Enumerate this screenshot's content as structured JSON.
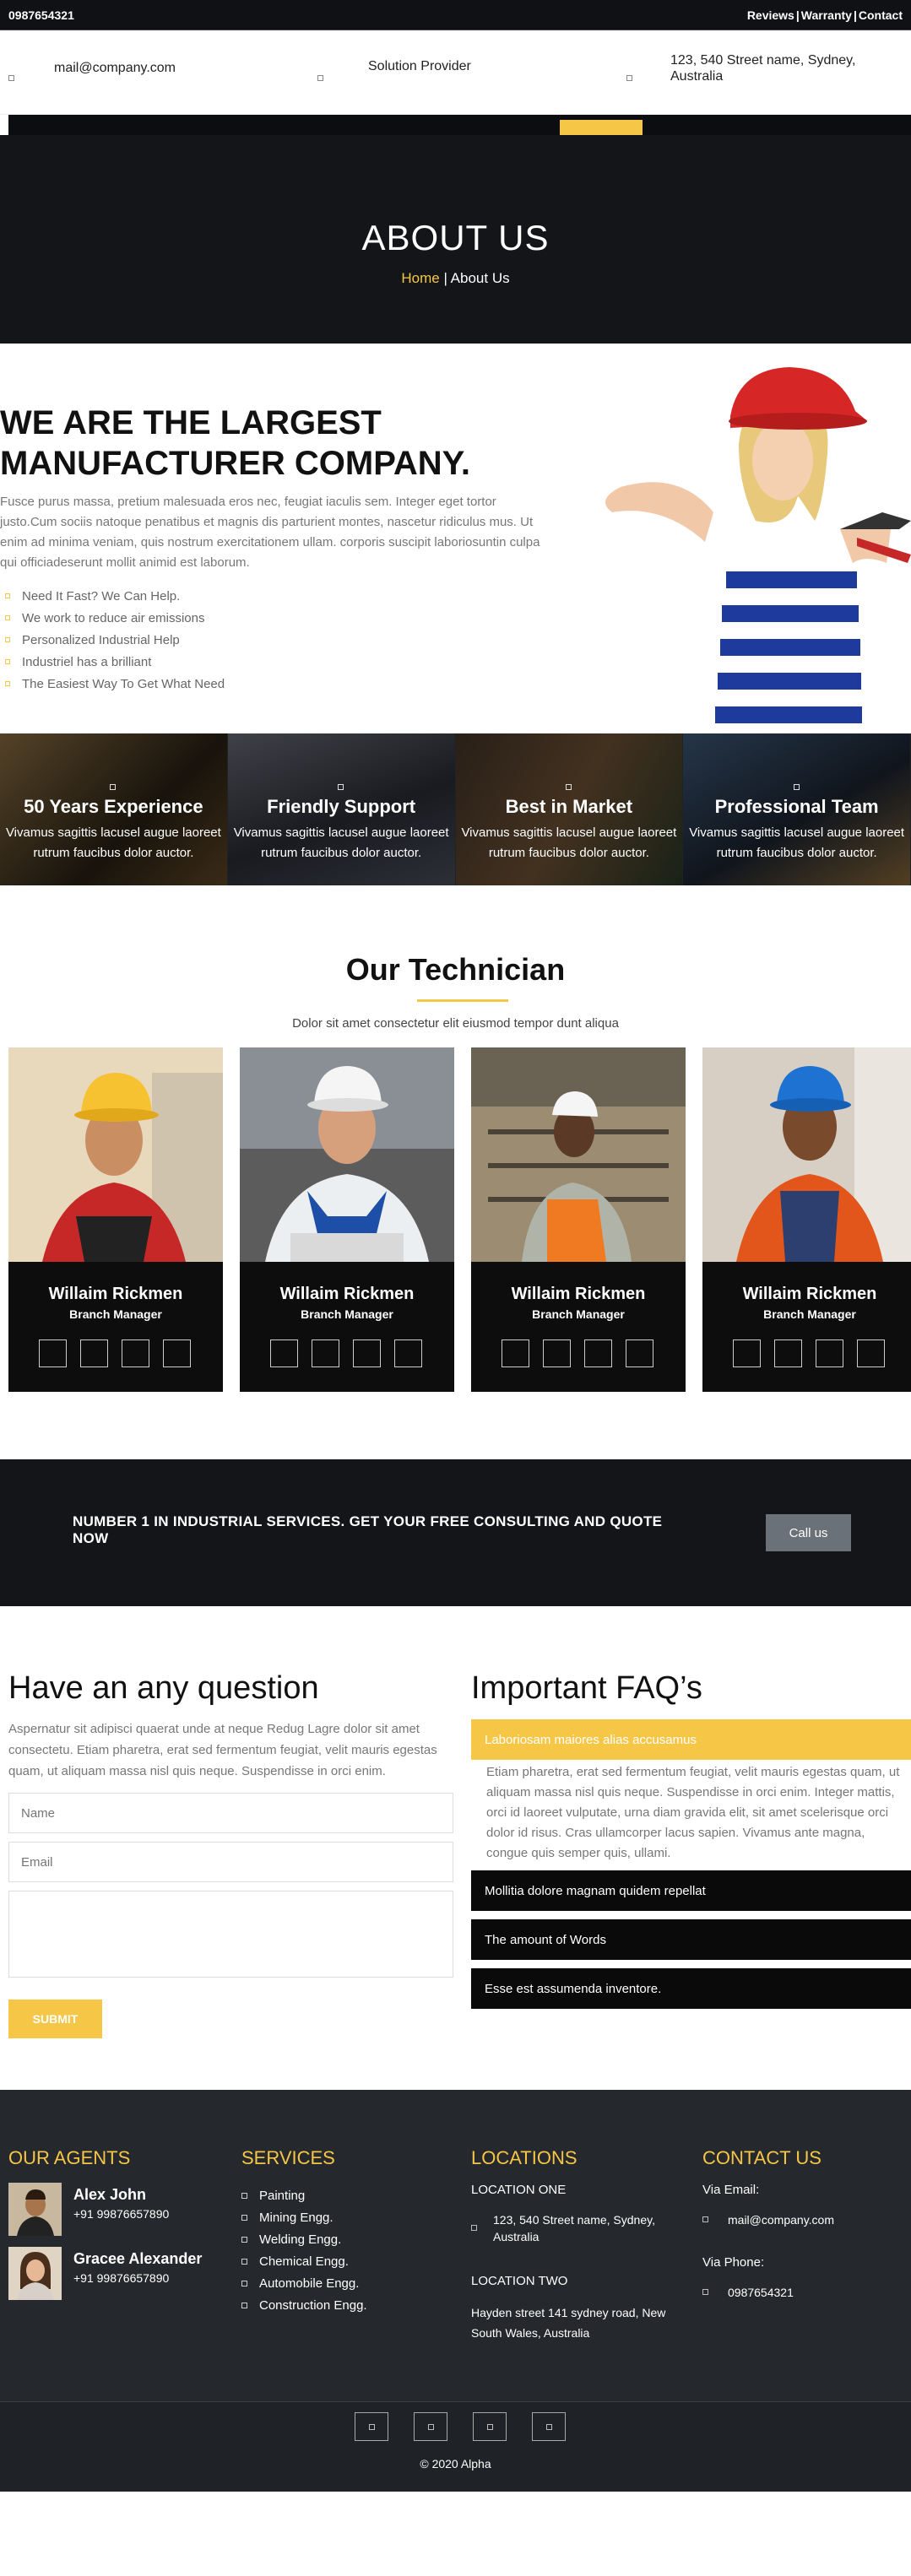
{
  "topbar": {
    "phone": "0987654321",
    "links": [
      "Reviews",
      "Warranty",
      "Contact"
    ],
    "sep": "|"
  },
  "infobar": {
    "email": "mail@company.com",
    "tagline": "Solution Provider",
    "address": "123, 540 Street name, Sydney, Australia"
  },
  "header": {
    "title": "ABOUT US",
    "crumb_home": "Home",
    "crumb_sep": " | ",
    "crumb_current": "About Us"
  },
  "about": {
    "heading": "WE ARE THE LARGEST MANUFACTURER COMPANY.",
    "text": "Fusce purus massa, pretium malesuada eros nec, feugiat iaculis sem. Integer eget tortor justo.Cum sociis natoque penatibus et magnis dis parturient montes, nascetur ridiculus mus. Ut enim ad minima veniam, quis nostrum exercitationem ullam. corporis suscipit laboriosuntin culpa qui officiadeserunt mollit animid est laborum.",
    "list": [
      "Need It Fast? We Can Help.",
      "We work to reduce air emissions",
      "Personalized Industrial Help",
      "Industriel has a brilliant",
      "The Easiest Way To Get What Need"
    ]
  },
  "features": [
    {
      "title": "50 Years Experience",
      "text": "Vivamus sagittis lacusel augue laoreet rutrum faucibus dolor auctor.",
      "bg": "#8a6a3c"
    },
    {
      "title": "Friendly Support",
      "text": "Vivamus sagittis lacusel augue laoreet rutrum faucibus dolor auctor.",
      "bg": "#3c4150"
    },
    {
      "title": "Best in Market",
      "text": "Vivamus sagittis lacusel augue laoreet rutrum faucibus dolor auctor.",
      "bg": "#5a4a3a"
    },
    {
      "title": "Professional Team",
      "text": "Vivamus sagittis lacusel augue laoreet rutrum faucibus dolor auctor.",
      "bg": "#2f3e4f"
    }
  ],
  "technicians": {
    "title": "Our Technician",
    "subtitle": "Dolor sit amet consectetur elit eiusmod tempor dunt aliqua",
    "members": [
      {
        "name": "Willaim Rickmen",
        "role": "Branch Manager"
      },
      {
        "name": "Willaim Rickmen",
        "role": "Branch Manager"
      },
      {
        "name": "Willaim Rickmen",
        "role": "Branch Manager"
      },
      {
        "name": "Willaim Rickmen",
        "role": "Branch Manager"
      }
    ]
  },
  "cta": {
    "text": "NUMBER 1 IN INDUSTRIAL SERVICES. GET YOUR FREE CONSULTING AND QUOTE NOW",
    "button": "Call us"
  },
  "question": {
    "title": "Have an any question",
    "text": "Aspernatur sit adipisci quaerat unde at neque Redug Lagre dolor sit amet consectetu. Etiam pharetra, erat sed fermentum feugiat, velit mauris egestas quam, ut aliquam massa nisl quis neque. Suspendisse in orci enim.",
    "name_placeholder": "Name",
    "email_placeholder": "Email",
    "submit": "SUBMIT"
  },
  "faq": {
    "title": "Important FAQ’s",
    "open_q": "Laboriosam maiores alias accusamus",
    "open_a": "Etiam pharetra, erat sed fermentum feugiat, velit mauris egestas quam, ut aliquam massa nisl quis neque. Suspendisse in orci enim. Integer mattis, orci id laoreet vulputate, urna diam gravida elit, sit amet scelerisque orci dolor id risus. Cras ullamcorper lacus sapien. Vivamus ante magna, congue quis semper quis, ullami.",
    "items": [
      "Mollitia dolore magnam quidem repellat",
      "The amount of Words",
      "Esse est assumenda inventore."
    ]
  },
  "footer": {
    "agents_title": "OUR AGENTS",
    "agents": [
      {
        "name": "Alex John",
        "phone": "+91 99876657890"
      },
      {
        "name": "Gracee Alexander",
        "phone": "+91 99876657890"
      }
    ],
    "services_title": "SERVICES",
    "services": [
      "Painting",
      "Mining Engg.",
      "Welding Engg.",
      "Chemical Engg.",
      "Automobile Engg.",
      "Construction Engg."
    ],
    "locations_title": "LOCATIONS",
    "loc1_title": "LOCATION ONE",
    "loc1_addr": "123, 540 Street name, Sydney, Australia",
    "loc2_title": "LOCATION TWO",
    "loc2_addr": "Hayden street 141 sydney road, New South Wales, Australia",
    "contact_title": "CONTACT US",
    "email_label": "Via Email:",
    "email": "mail@company.com",
    "phone_label": "Via Phone:",
    "phone": "0987654321",
    "copyright": "© 2020 Alpha"
  },
  "colors": {
    "accent": "#f6c647",
    "dark": "#141519",
    "footer": "#25282c"
  }
}
